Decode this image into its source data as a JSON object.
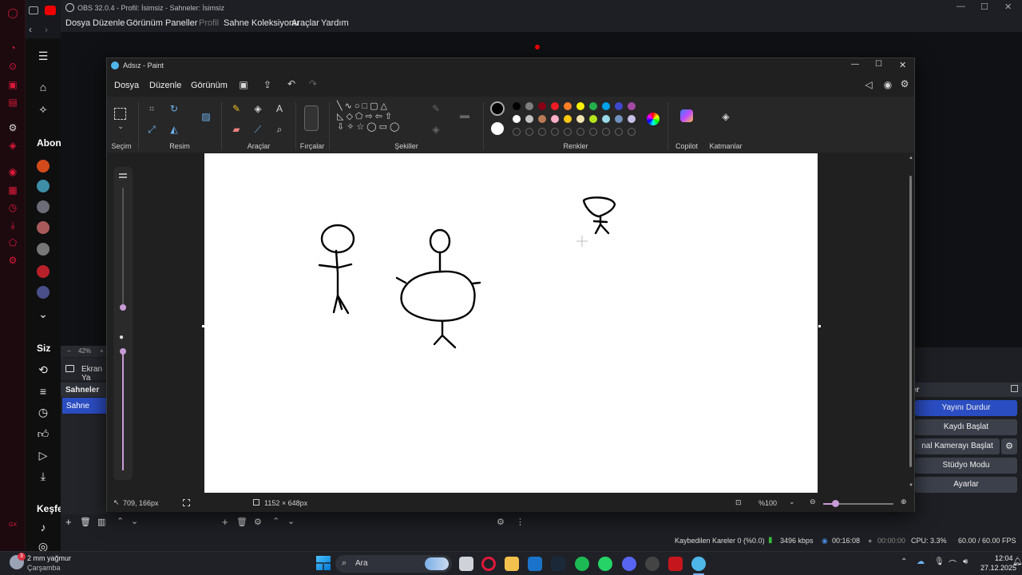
{
  "obs": {
    "title": "OBS 32.0.4 - Profil: İsimsiz - Sahneler: İsimsiz",
    "menu": [
      "Dosya",
      "Düzenle",
      "Görünüm",
      "Paneller",
      "Profil",
      "Sahne Koleksiyonu",
      "Araçlar",
      "Yardım"
    ],
    "zoom_label": "42%",
    "source_label": "Ekran Ya",
    "scenes_title": "Sahneler",
    "scene_item": "Sahne",
    "controls_title": "er",
    "buttons": {
      "stop_stream": "Yayını Durdur",
      "start_record": "Kaydı Başlat",
      "virtual_cam": "nal Kamerayı Başlat",
      "studio_mode": "Stüdyo Modu",
      "settings": "Ayarlar"
    },
    "status": {
      "dropped": "Kaybedilen Kareler 0 (%0.0)",
      "bitrate": "3496 kbps",
      "stream_time": "00:16:08",
      "rec_time": "00:00:00",
      "cpu": "CPU: 3.3%",
      "fps": "60.00 / 60.00 FPS"
    }
  },
  "yt": {
    "subs_label": "Abone",
    "you_label": "Siz",
    "explore_label": "Keşfet"
  },
  "paint": {
    "title": "Adsız - Paint",
    "menu": [
      "Dosya",
      "Düzenle",
      "Görünüm"
    ],
    "groups": {
      "selection": "Seçim",
      "image": "Resim",
      "tools": "Araçlar",
      "brushes": "Fırçalar",
      "shapes": "Şekiller",
      "colors": "Renkler",
      "copilot": "Copilot",
      "layers": "Katmanlar"
    },
    "status": {
      "cursor": "709, 166px",
      "size": "1152 × 648px",
      "zoom": "%100"
    },
    "colors": {
      "row1": [
        "#000000",
        "#7f7f7f",
        "#880015",
        "#ed1c24",
        "#ff7f27",
        "#fff200",
        "#22b14c",
        "#00a2e8",
        "#3f48cc",
        "#a349a4"
      ],
      "row2": [
        "#ffffff",
        "#c3c3c3",
        "#b97a57",
        "#ffaec9",
        "#ffc90e",
        "#efe4b0",
        "#b5e61d",
        "#99d9ea",
        "#7092be",
        "#c8bfe7"
      ]
    }
  },
  "taskbar": {
    "weather_temp": "2 mm yağmur",
    "weather_day": "Çarşamba",
    "weather_badge": "3",
    "search": "Ara",
    "time": "12:04",
    "date": "27.12.2025"
  }
}
